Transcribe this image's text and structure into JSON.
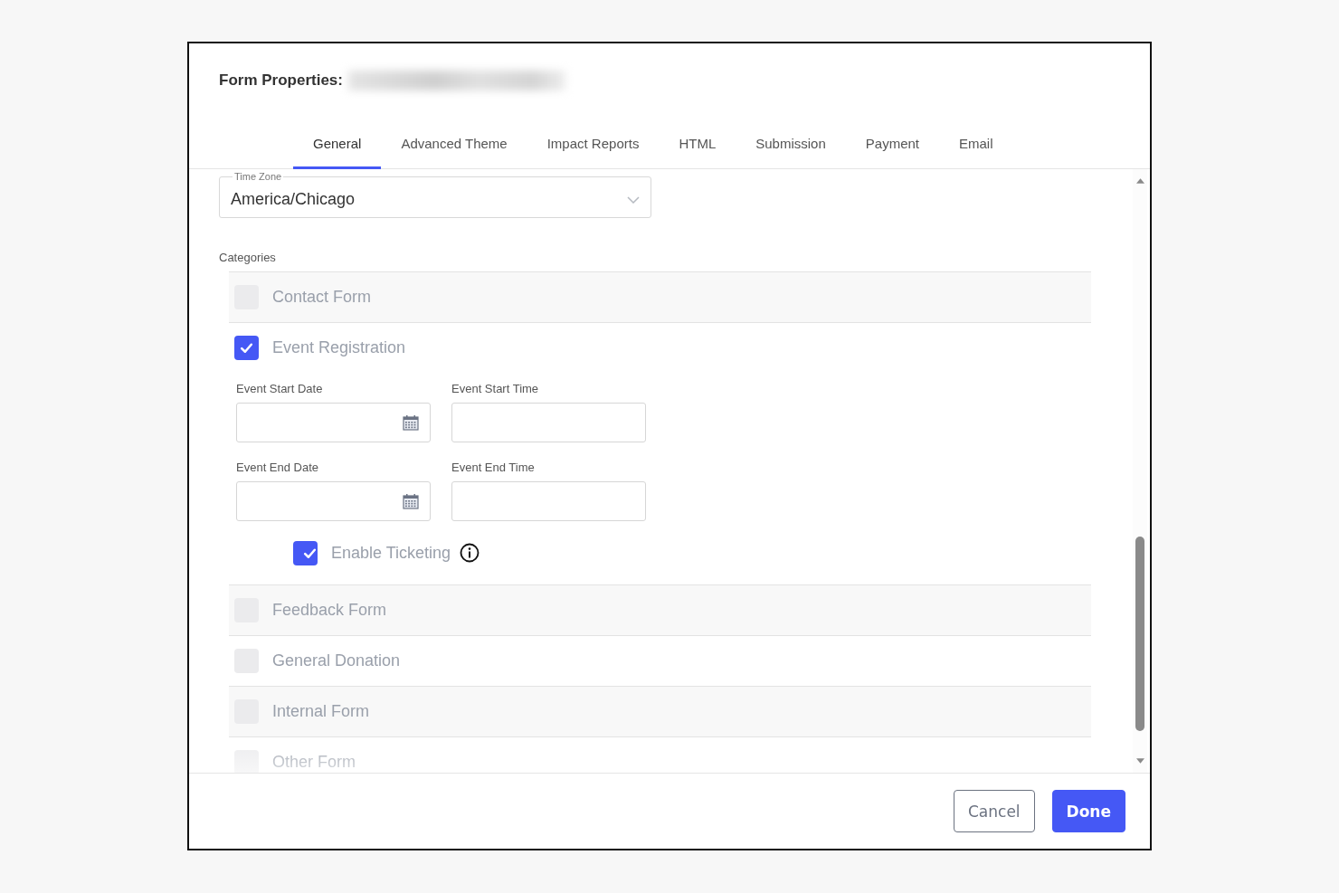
{
  "dialog": {
    "title": "Form Properties:",
    "title_redacted": true
  },
  "tabs": [
    {
      "label": "General",
      "selected": true
    },
    {
      "label": "Advanced Theme",
      "selected": false
    },
    {
      "label": "Impact Reports",
      "selected": false
    },
    {
      "label": "HTML",
      "selected": false
    },
    {
      "label": "Submission",
      "selected": false
    },
    {
      "label": "Payment",
      "selected": false
    },
    {
      "label": "Email",
      "selected": false
    }
  ],
  "time_zone": {
    "label": "Time Zone",
    "value": "America/Chicago"
  },
  "categories": {
    "label": "Categories",
    "items": [
      {
        "label": "Contact Form",
        "checked": false
      },
      {
        "label": "Event Registration",
        "checked": true,
        "fields": [
          {
            "label": "Event Start Date",
            "kind": "date"
          },
          {
            "label": "Event Start Time",
            "kind": "time"
          },
          {
            "label": "Event End Date",
            "kind": "date"
          },
          {
            "label": "Event End Time",
            "kind": "time"
          }
        ],
        "options": [
          {
            "label": "Enable Ticketing",
            "checked": true,
            "info": true
          }
        ]
      },
      {
        "label": "Feedback Form",
        "checked": false
      },
      {
        "label": "General Donation",
        "checked": false
      },
      {
        "label": "Internal Form",
        "checked": false
      },
      {
        "label": "Other Form",
        "checked": false
      }
    ]
  },
  "buttons": [
    {
      "label": "Cancel",
      "kind": "secondary"
    },
    {
      "label": "Done",
      "kind": "primary"
    }
  ]
}
